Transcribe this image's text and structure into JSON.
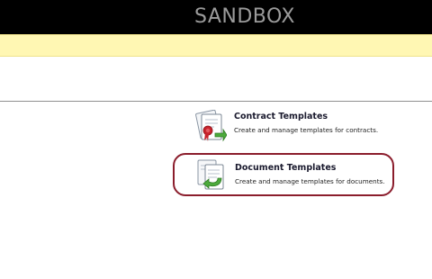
{
  "header": {
    "title": "SANDBOX"
  },
  "notice_bar": {
    "color": "#fff7b3"
  },
  "tiles": [
    {
      "title": "Contract Templates",
      "description": "Create and manage templates for contracts.",
      "icon": "contract-certificate-icon"
    },
    {
      "title": "Document Templates",
      "description": "Create and manage templates for documents.",
      "icon": "document-template-icon",
      "selected": true
    }
  ],
  "colors": {
    "header_bg": "#000000",
    "header_text": "#9b9b9b",
    "selected_border": "#8b1d2c"
  }
}
